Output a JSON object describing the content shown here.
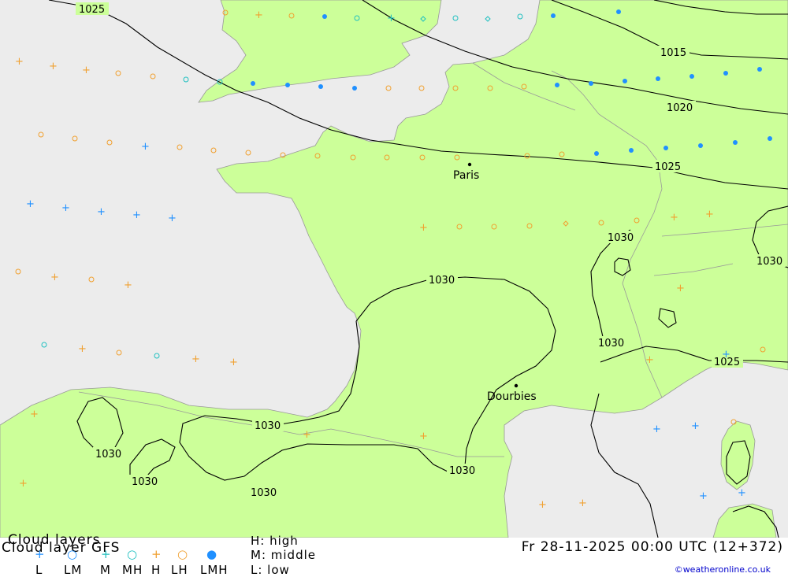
{
  "map": {
    "colors": {
      "sea": "#ececec",
      "land": "#ccff99",
      "border": "#999999",
      "isobar": "#000000",
      "high": "#f0a030",
      "middle": "#2090ff",
      "low": "#20c0c0"
    },
    "isobar_labels": [
      "1025",
      "1015",
      "1020",
      "1025",
      "1030",
      "1030",
      "1030",
      "1030",
      "1030",
      "1030",
      "1030",
      "1030",
      "1025"
    ],
    "cities": [
      "Paris",
      "Dourbies"
    ]
  },
  "footer": {
    "title_line1": "Cloud layers",
    "title_line2": "Cloud layer   GFS",
    "legend_labels": [
      "L",
      "LM",
      "M",
      "MH",
      "H",
      "LH",
      "LMH"
    ],
    "key_high": "H: high",
    "key_middle": "M: middle",
    "key_low": "L: low",
    "datetime": "Fr 28-11-2025 00:00 UTC (12+372)",
    "credit": "©weatheronline.co.uk"
  }
}
